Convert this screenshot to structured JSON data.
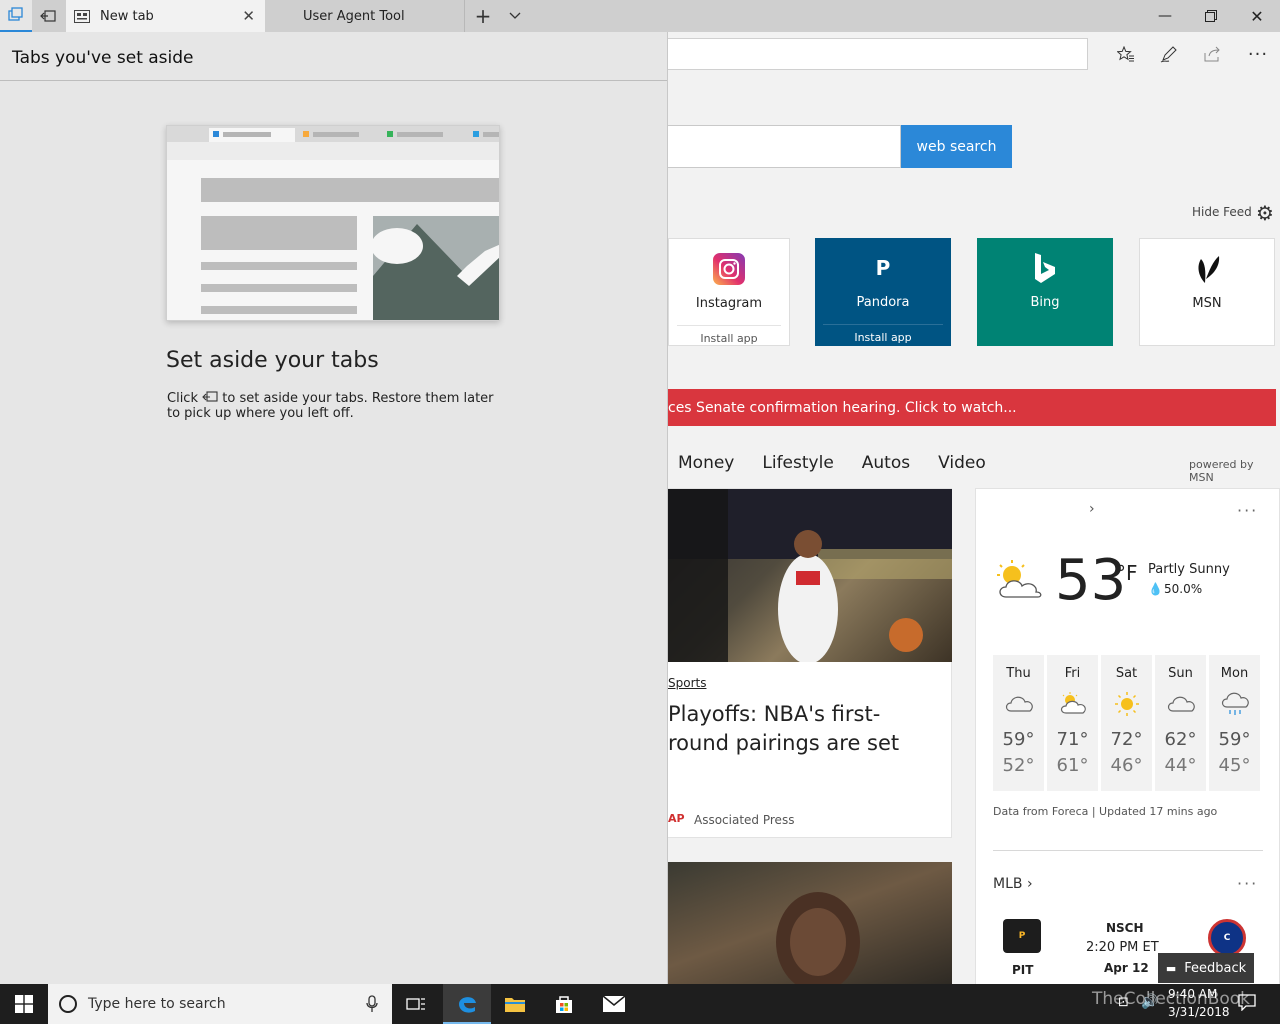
{
  "titlebar": {
    "tabs": [
      {
        "label": "New tab",
        "active": true
      },
      {
        "label": "User Agent Tool",
        "active": false
      }
    ]
  },
  "page": {
    "search_button": "web search",
    "hide_feed": "Hide Feed",
    "tiles": [
      {
        "name": "Instagram",
        "install": "Install app"
      },
      {
        "name": "Pandora",
        "icon_text": "P",
        "install": "Install app"
      },
      {
        "name": "Bing"
      },
      {
        "name": "MSN"
      }
    ],
    "banner": "ces Senate confirmation hearing. Click to watch...",
    "nav": [
      "Money",
      "Lifestyle",
      "Autos",
      "Video"
    ],
    "powered_by": "powered by MSN",
    "story": {
      "category": "Sports",
      "headline": "Playoffs: NBA's first-round pairings are set",
      "source_badge": "AP",
      "source": "Associated Press"
    },
    "weather": {
      "temp": "53",
      "unit": "°F",
      "condition": "Partly Sunny",
      "precip": "50.0%",
      "days": [
        {
          "name": "Thu",
          "hi": "59°",
          "lo": "52°",
          "icon": "cloud-icon"
        },
        {
          "name": "Fri",
          "hi": "71°",
          "lo": "61°",
          "icon": "partly-sunny-icon"
        },
        {
          "name": "Sat",
          "hi": "72°",
          "lo": "46°",
          "icon": "sun-icon"
        },
        {
          "name": "Sun",
          "hi": "62°",
          "lo": "44°",
          "icon": "cloud-icon"
        },
        {
          "name": "Mon",
          "hi": "59°",
          "lo": "45°",
          "icon": "rain-icon"
        }
      ],
      "source": "Data from Foreca | Updated 17 mins ago"
    },
    "mlb": {
      "title": "MLB",
      "team1": "PIT",
      "venue": "NSCH",
      "time": "2:20 PM ET",
      "date": "Apr 12"
    },
    "feedback": "Feedback"
  },
  "panel": {
    "title": "Tabs you've set aside",
    "heading": "Set aside your tabs",
    "text_before": "Click",
    "text_after": "to set aside your tabs. Restore them later to pick up where you left off."
  },
  "taskbar": {
    "search_placeholder": "Type here to search",
    "time": "9:40 AM",
    "date": "3/31/2018",
    "watermark": "TheCollectionBook"
  },
  "colors": {
    "accent_blue": "#2b88d8",
    "banner_red": "#d9363e",
    "pandora": "#005483",
    "bing": "#008374"
  }
}
